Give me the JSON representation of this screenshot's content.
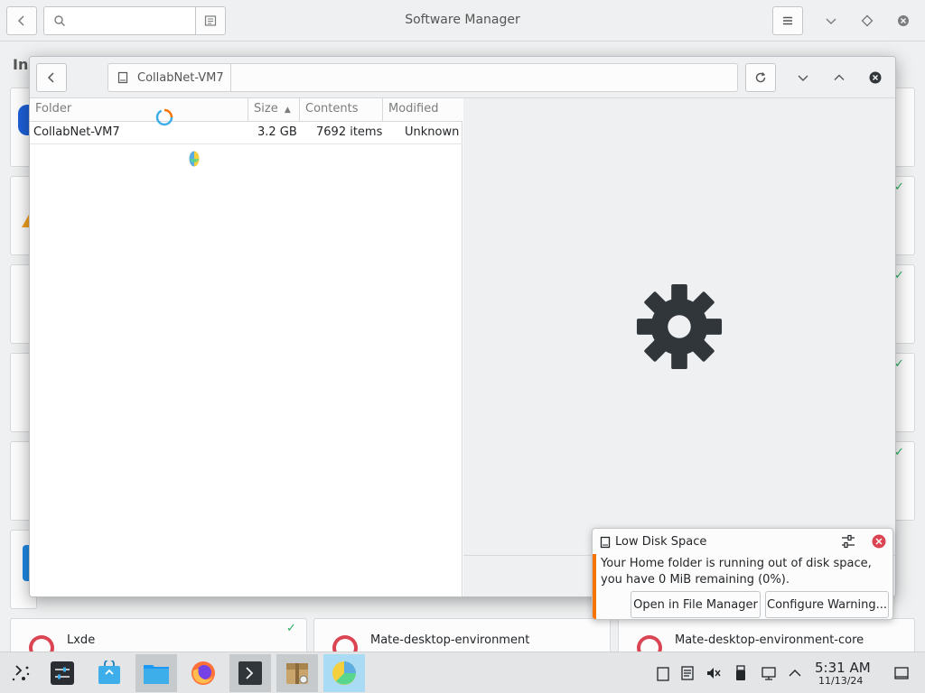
{
  "background_window": {
    "title": "Software Manager",
    "sidebar_label_partial": "In",
    "cards_bottom": [
      {
        "title": "Lxde"
      },
      {
        "title": "Mate-desktop-environment"
      },
      {
        "title": "Mate-desktop-environment-core"
      }
    ]
  },
  "dialog": {
    "path_segment": "CollabNet-VM7",
    "columns": [
      "Folder",
      "Size",
      "Contents",
      "Modified"
    ],
    "sort_indicator": "▲",
    "rows": [
      {
        "folder": "CollabNet-VM7",
        "size": "3.2 GB",
        "contents": "7692 items",
        "modified": "Unknown"
      }
    ]
  },
  "notification": {
    "title": "Low Disk Space",
    "body_line1": "Your Home folder is running out of disk space,",
    "body_line2": "you have 0 MiB remaining (0%).",
    "open_button": "Open in File Manager",
    "configure_button": "Configure Warning..."
  },
  "taskbar": {
    "time": "5:31 AM",
    "date": "11/13/24"
  },
  "colors": {
    "accent": "#3daee9",
    "warning": "#f67400",
    "error": "#da4453"
  }
}
